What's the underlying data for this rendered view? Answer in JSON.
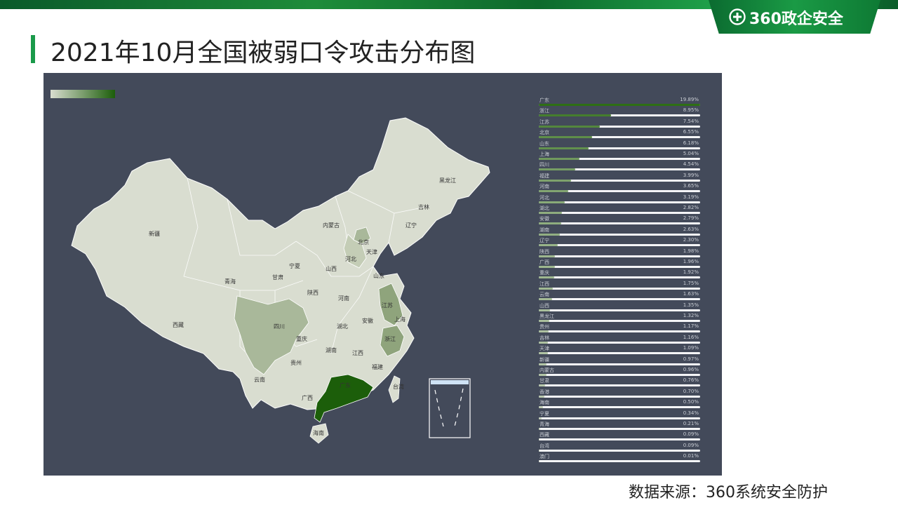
{
  "header": {
    "brand": "360政企安全"
  },
  "title": "2021年10月全国被弱口令攻击分布图",
  "source": "数据来源：360系统安全防护",
  "colors": {
    "scale_low": "#d9ddd0",
    "scale_high": "#1c5e0a",
    "panel_bg": "#434a5a"
  },
  "chart_data": {
    "type": "bar",
    "categories": [
      "广东",
      "浙江",
      "江苏",
      "北京",
      "山东",
      "上海",
      "四川",
      "福建",
      "河南",
      "河北",
      "湖北",
      "安徽",
      "湖南",
      "辽宁",
      "陕西",
      "广西",
      "重庆",
      "江西",
      "云南",
      "山西",
      "黑龙江",
      "贵州",
      "吉林",
      "天津",
      "新疆",
      "内蒙古",
      "甘肃",
      "香港",
      "海南",
      "宁夏",
      "青海",
      "西藏",
      "台湾",
      "澳门"
    ],
    "values": [
      19.89,
      8.95,
      7.54,
      6.55,
      6.18,
      5.04,
      4.54,
      3.99,
      3.65,
      3.19,
      2.82,
      2.79,
      2.63,
      2.3,
      1.98,
      1.96,
      1.92,
      1.75,
      1.63,
      1.35,
      1.32,
      1.17,
      1.16,
      1.09,
      0.97,
      0.96,
      0.76,
      0.7,
      0.5,
      0.34,
      0.21,
      0.09,
      0.09,
      0.01
    ],
    "labels": [
      "19.89%",
      "8.95%",
      "7.54%",
      "6.55%",
      "6.18%",
      "5.04%",
      "4.54%",
      "3.99%",
      "3.65%",
      "3.19%",
      "2.82%",
      "2.79%",
      "2.63%",
      "2.30%",
      "1.98%",
      "1.96%",
      "1.92%",
      "1.75%",
      "1.63%",
      "1.35%",
      "1.32%",
      "1.17%",
      "1.16%",
      "1.09%",
      "0.97%",
      "0.96%",
      "0.76%",
      "0.70%",
      "0.50%",
      "0.34%",
      "0.21%",
      "0.09%",
      "0.09%",
      "0.01%"
    ],
    "orientation": "horizontal",
    "ylim": [
      0,
      19.89
    ]
  },
  "map": {
    "labels": [
      "新疆",
      "西藏",
      "青海",
      "甘肃",
      "内蒙古",
      "黑龙江",
      "吉林",
      "辽宁",
      "北京",
      "天津",
      "河北",
      "山西",
      "宁夏",
      "陕西",
      "山东",
      "河南",
      "江苏",
      "安徽",
      "湖北",
      "四川",
      "重庆",
      "湖南",
      "江西",
      "浙江",
      "上海",
      "贵州",
      "云南",
      "广西",
      "福建",
      "广东",
      "台湾",
      "海南"
    ]
  }
}
